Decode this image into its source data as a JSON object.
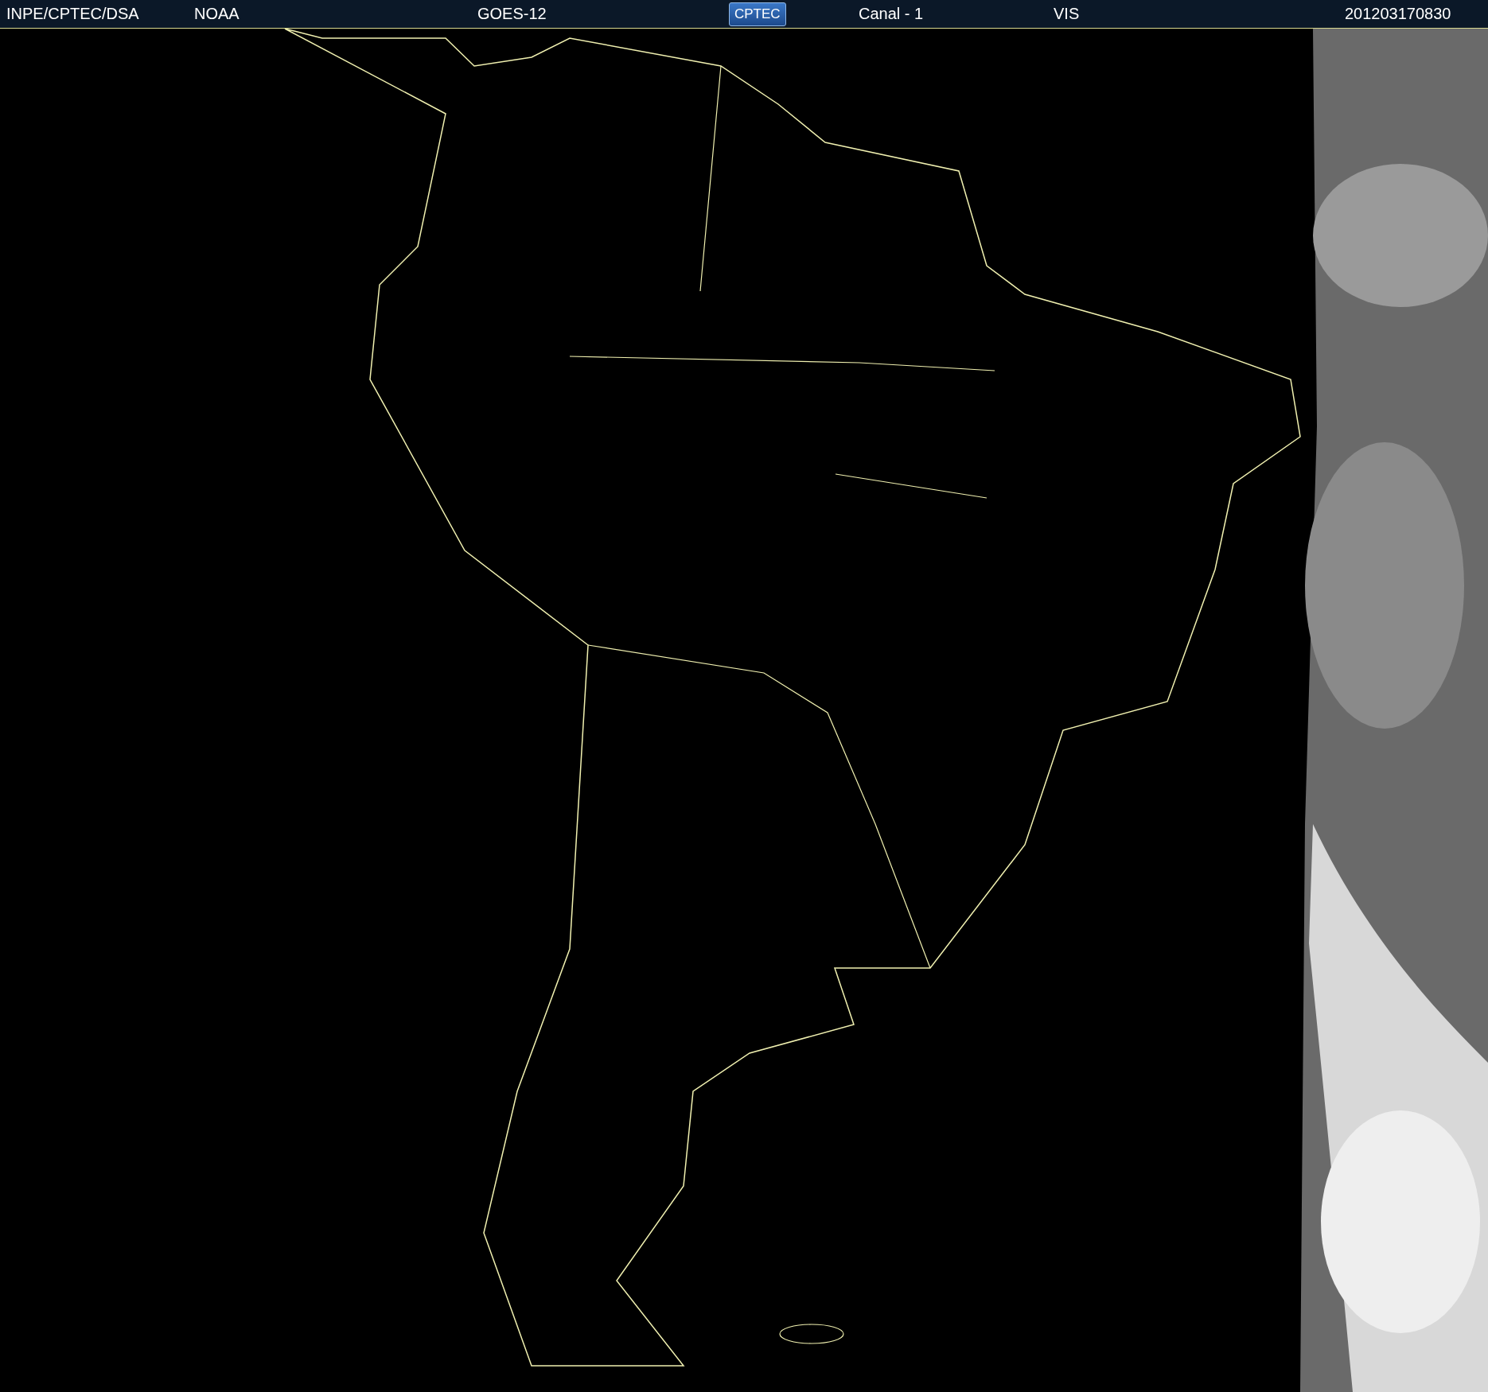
{
  "header": {
    "items": [
      {
        "kind": "text",
        "text": "INPE/CPTEC/DSA"
      },
      {
        "kind": "text",
        "text": "NOAA"
      },
      {
        "kind": "text",
        "text": "GOES-12"
      },
      {
        "kind": "logo",
        "text": "CPTEC"
      },
      {
        "kind": "text",
        "text": "Canal - 1"
      },
      {
        "kind": "text",
        "text": "VIS"
      },
      {
        "kind": "text",
        "text": "201203170830"
      }
    ]
  }
}
